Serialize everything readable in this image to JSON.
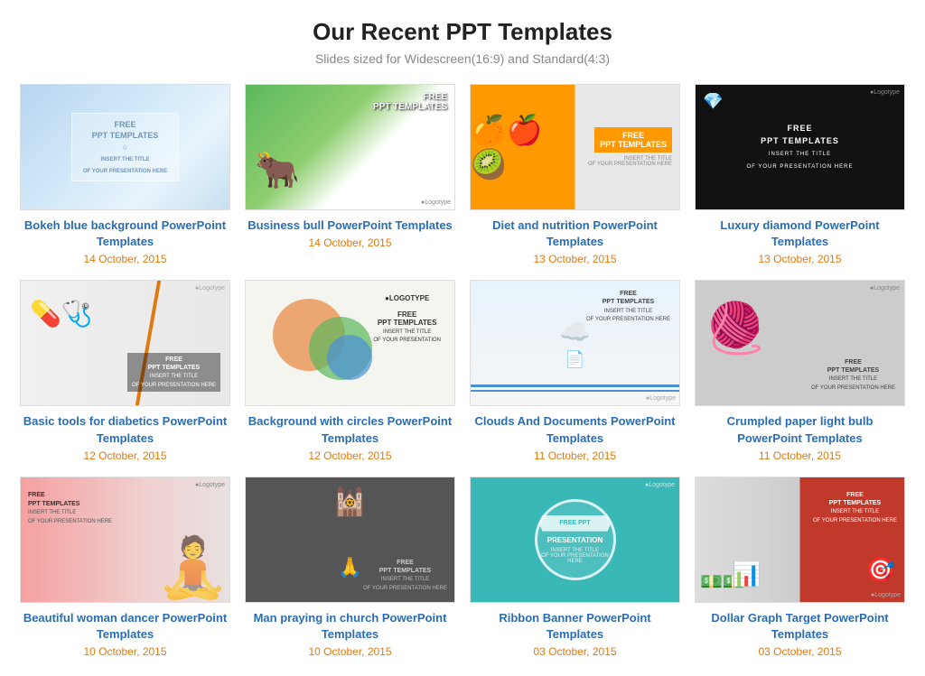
{
  "header": {
    "title": "Our Recent PPT Templates",
    "subtitle": "Slides sized for Widescreen(16:9) and Standard(4:3)"
  },
  "templates": [
    {
      "id": 1,
      "title": "Bokeh blue background PowerPoint Templates",
      "date": "14 October, 2015",
      "thumb_type": "bokeh"
    },
    {
      "id": 2,
      "title": "Business bull PowerPoint Templates",
      "date": "14 October, 2015",
      "thumb_type": "bull"
    },
    {
      "id": 3,
      "title": "Diet and nutrition PowerPoint Templates",
      "date": "13 October, 2015",
      "thumb_type": "diet"
    },
    {
      "id": 4,
      "title": "Luxury diamond PowerPoint Templates",
      "date": "13 October, 2015",
      "thumb_type": "diamond"
    },
    {
      "id": 5,
      "title": "Basic tools for diabetics PowerPoint Templates",
      "date": "12 October, 2015",
      "thumb_type": "diabetics"
    },
    {
      "id": 6,
      "title": "Background with circles PowerPoint Templates",
      "date": "12 October, 2015",
      "thumb_type": "circles"
    },
    {
      "id": 7,
      "title": "Clouds And Documents PowerPoint Templates",
      "date": "11 October, 2015",
      "thumb_type": "clouds"
    },
    {
      "id": 8,
      "title": "Crumpled paper light bulb PowerPoint Templates",
      "date": "11 October, 2015",
      "thumb_type": "crumpled"
    },
    {
      "id": 9,
      "title": "Beautiful woman dancer PowerPoint Templates",
      "date": "10 October, 2015",
      "thumb_type": "dancer"
    },
    {
      "id": 10,
      "title": "Man praying in church PowerPoint Templates",
      "date": "10 October, 2015",
      "thumb_type": "church"
    },
    {
      "id": 11,
      "title": "Ribbon Banner PowerPoint Templates",
      "date": "03 October, 2015",
      "thumb_type": "ribbon"
    },
    {
      "id": 12,
      "title": "Dollar Graph Target PowerPoint Templates",
      "date": "03 October, 2015",
      "thumb_type": "dollar"
    }
  ],
  "free_badge": {
    "line1": "FREE",
    "line2": "PPT TEMPLATES"
  }
}
